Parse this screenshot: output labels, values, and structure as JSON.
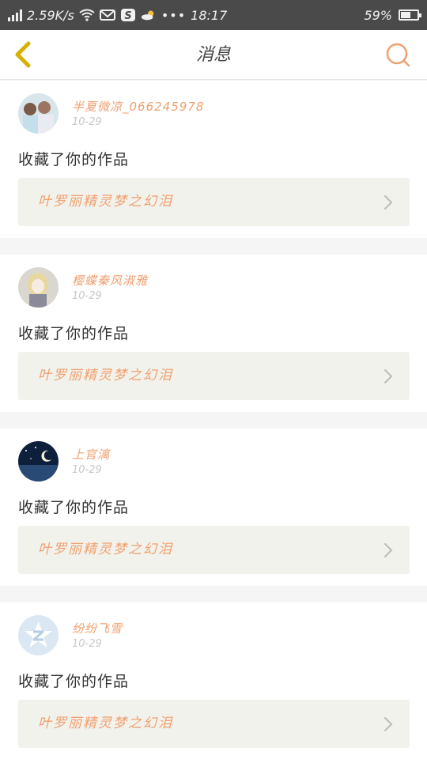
{
  "status_bar": {
    "net_speed": "2.59K/s",
    "time": "18:17",
    "battery_text": "59%",
    "battery_level": 0.59,
    "icons": [
      "signal-icon",
      "wifi-icon",
      "mail-icon",
      "s-app-icon",
      "weather-icon",
      "more-dots-icon",
      "battery-icon"
    ]
  },
  "header": {
    "title": "消息",
    "back_icon": "chevron-left-icon",
    "search_icon": "search-icon"
  },
  "colors": {
    "accent": "#f0a070",
    "back": "#d9b000",
    "status_bar_bg": "#4a4a4a",
    "card_bg": "#ffffff",
    "work_bg": "#f2f2ec"
  },
  "messages": [
    {
      "username": "半夏微凉_066245978",
      "date": "10-29",
      "action": "收藏了你的作品",
      "work_title": "叶罗丽精灵梦之幻泪",
      "avatar": "photo-avatar"
    },
    {
      "username": "樱蝶秦风淑雅",
      "date": "10-29",
      "action": "收藏了你的作品",
      "work_title": "叶罗丽精灵梦之幻泪",
      "avatar": "anime-avatar"
    },
    {
      "username": "上官漓",
      "date": "10-29",
      "action": "收藏了你的作品",
      "work_title": "叶罗丽精灵梦之幻泪",
      "avatar": "night-sky-avatar"
    },
    {
      "username": "纷纷飞雪",
      "date": "10-29",
      "action": "收藏了你的作品",
      "work_title": "叶罗丽精灵梦之幻泪",
      "avatar": "default-qq-avatar"
    }
  ]
}
